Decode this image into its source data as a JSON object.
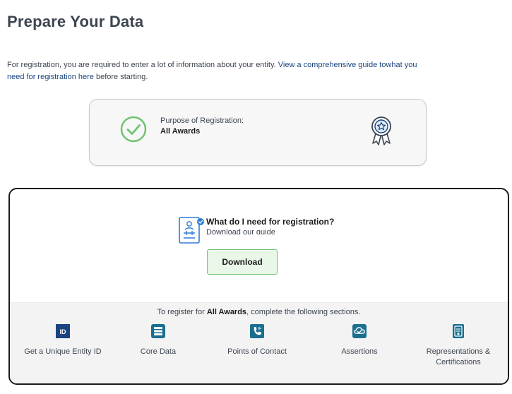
{
  "page": {
    "title": "Prepare Your Data"
  },
  "intro": {
    "lead": "For registration, you are required to enter a lot of information about your entity. ",
    "link": "View a comprehensive guide towhat you need for registration here",
    "tail": " before starting."
  },
  "purpose": {
    "label": "Purpose of Registration:",
    "value": "All Awards",
    "icons": {
      "status": "check-circle-icon",
      "badge": "award-ribbon-icon"
    },
    "check_color": "#70c270"
  },
  "guide": {
    "question": "What do I need for registration?",
    "subtitle": "Download our guide",
    "download_label": "Download",
    "icon": "document-guide-icon"
  },
  "sections": {
    "lead_prefix": "To register for ",
    "lead_bold": "All Awards",
    "lead_suffix": ", complete the following sections.",
    "steps": [
      {
        "label": "Get a Unique Entity ID",
        "icon": "id-card-icon",
        "color": "#1a4480"
      },
      {
        "label": "Core Data",
        "icon": "database-list-icon",
        "color": "#1a6f8f"
      },
      {
        "label": "Points of Contact",
        "icon": "contact-phone-icon",
        "color": "#1a6f8f"
      },
      {
        "label": "Assertions",
        "icon": "assertion-cloud-icon",
        "color": "#1a6f8f"
      },
      {
        "label": "Representations & Certifications",
        "icon": "certificate-clipboard-icon",
        "color": "#1a6f8f"
      }
    ]
  }
}
